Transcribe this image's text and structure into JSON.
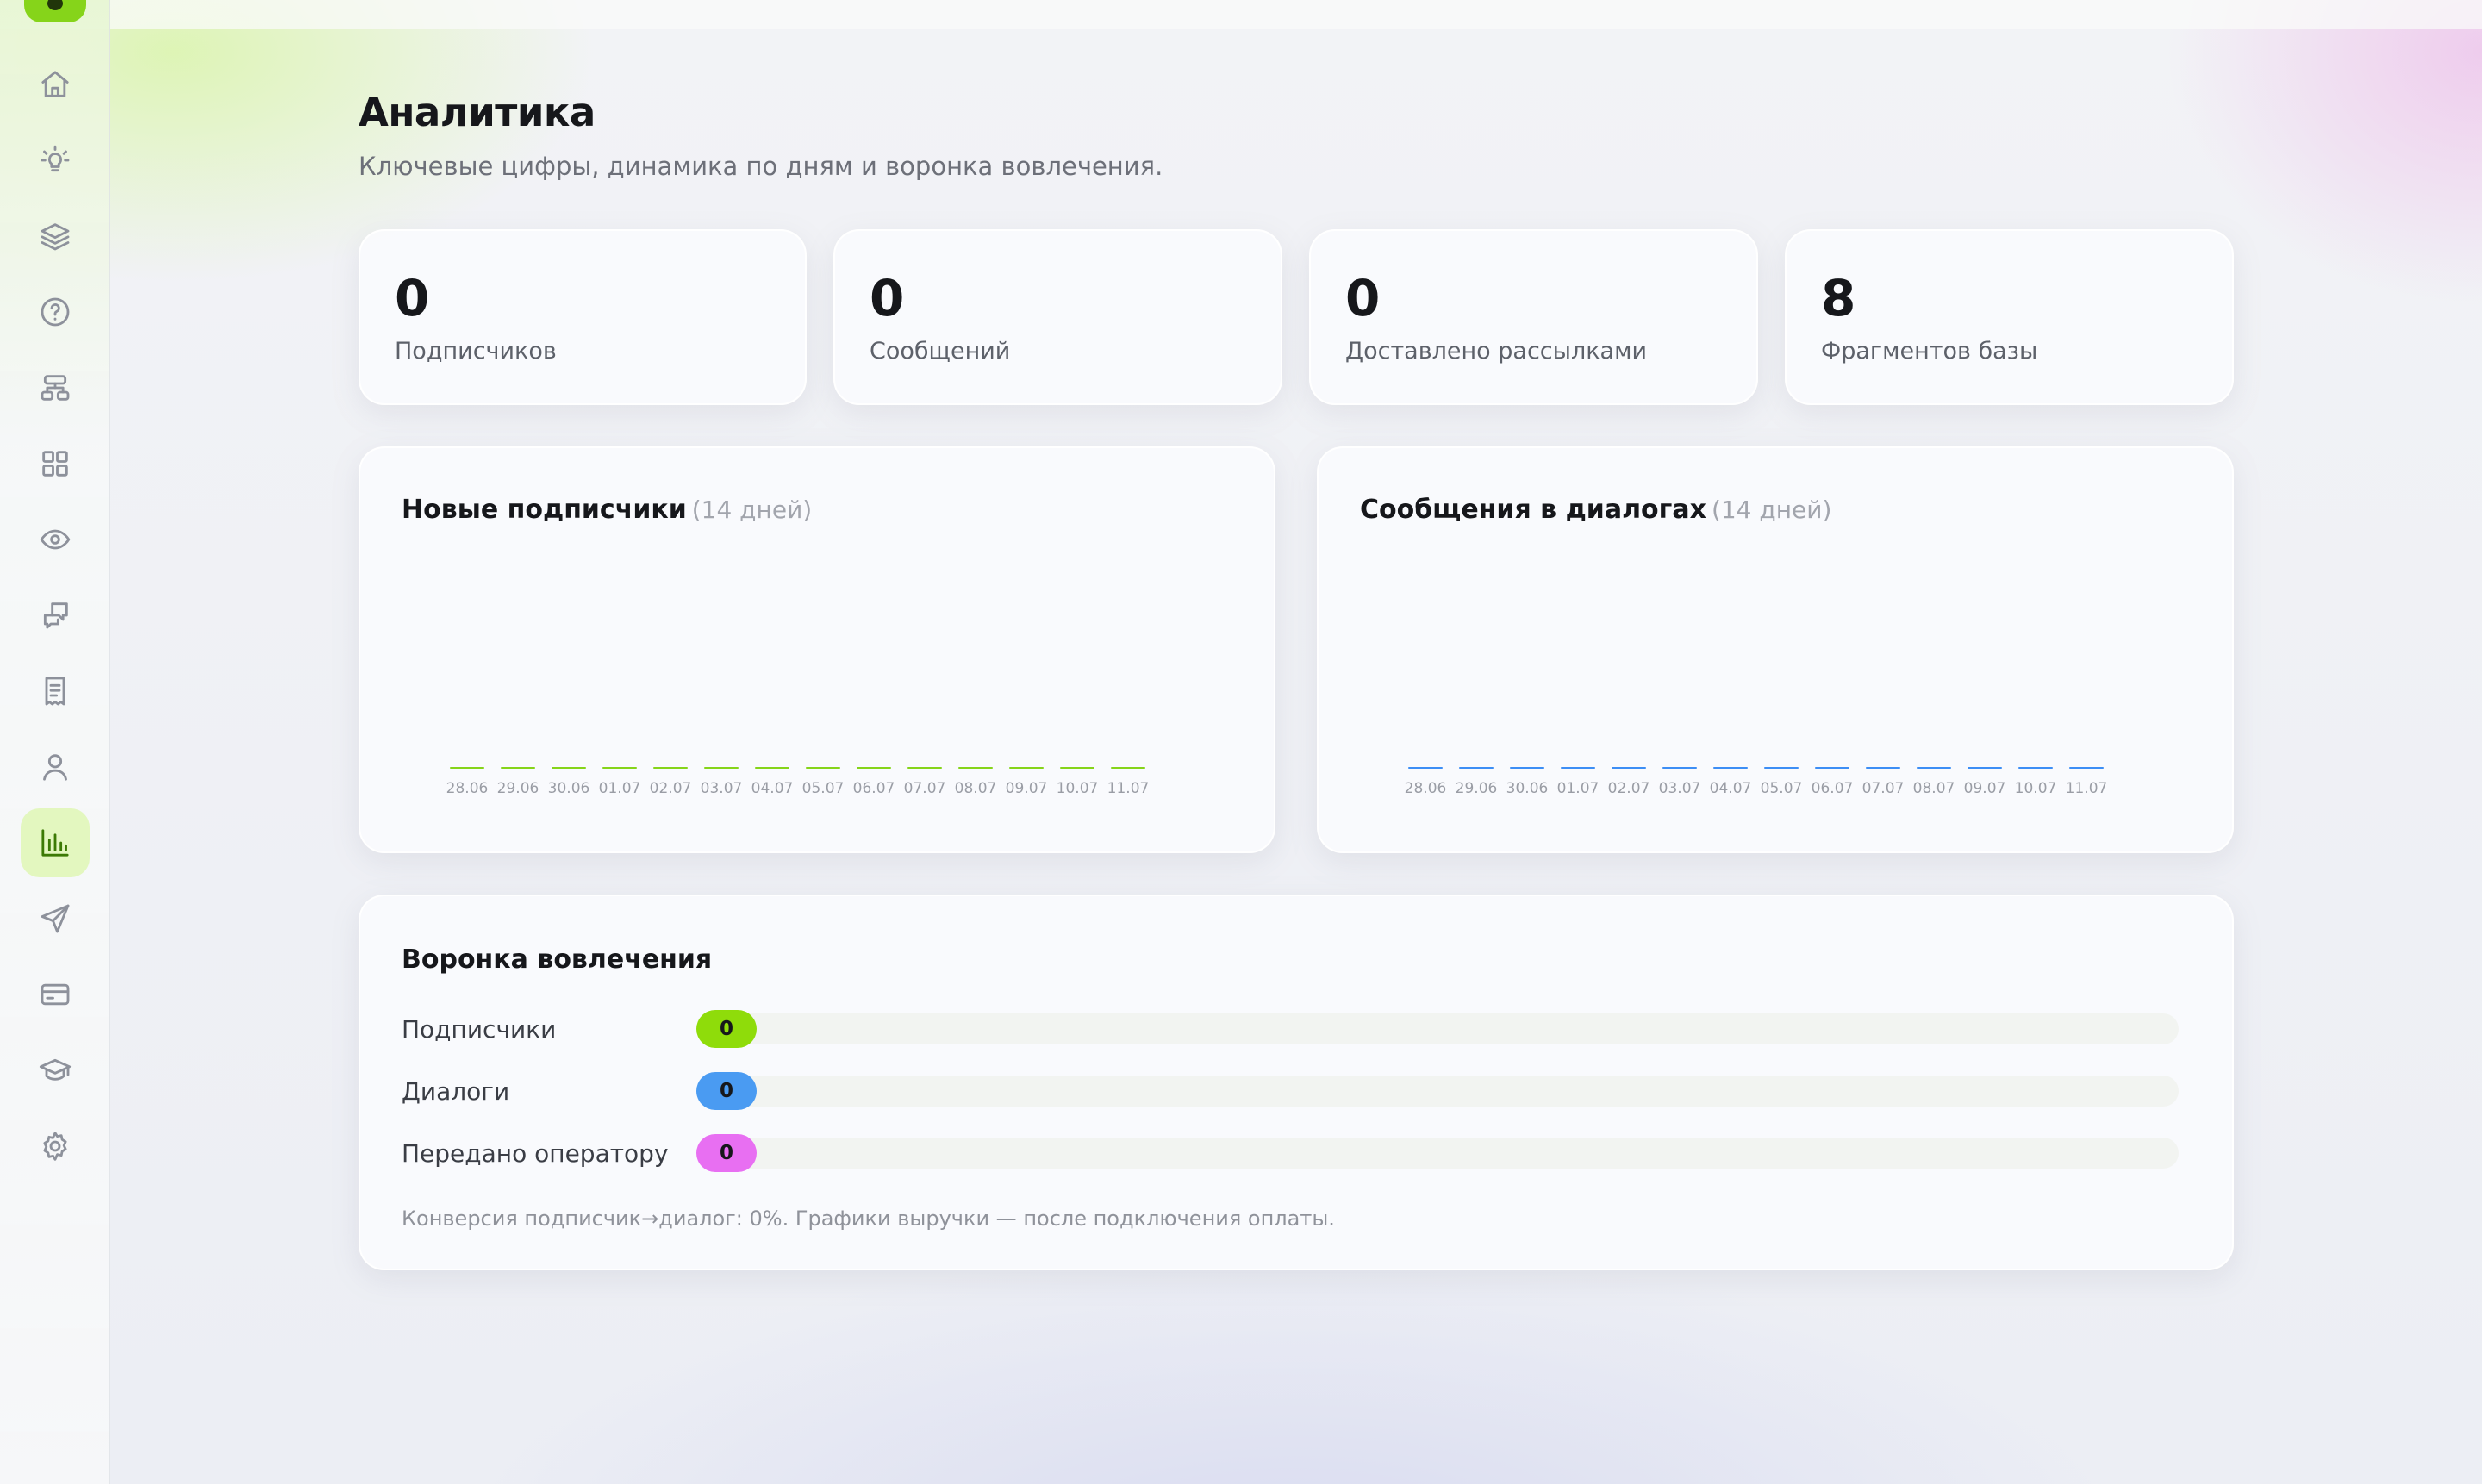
{
  "app": {
    "accent_color": "#86d41a"
  },
  "sidebar": {
    "items": [
      {
        "name": "home",
        "icon": "home-icon",
        "active": false
      },
      {
        "name": "ideas",
        "icon": "lightbulb-icon",
        "active": false
      },
      {
        "name": "knowledge",
        "icon": "layers-icon",
        "active": false
      },
      {
        "name": "faq",
        "icon": "help-circle-icon",
        "active": false
      },
      {
        "name": "flows",
        "icon": "workflow-icon",
        "active": false
      },
      {
        "name": "apps",
        "icon": "grid-icon",
        "active": false
      },
      {
        "name": "preview",
        "icon": "eye-icon",
        "active": false
      },
      {
        "name": "dialogs",
        "icon": "chat-bubbles-icon",
        "active": false
      },
      {
        "name": "logs",
        "icon": "receipt-icon",
        "active": false
      },
      {
        "name": "subscribers",
        "icon": "user-icon",
        "active": false
      },
      {
        "name": "analytics",
        "icon": "bar-chart-icon",
        "active": true
      },
      {
        "name": "broadcasts",
        "icon": "send-icon",
        "active": false
      },
      {
        "name": "billing",
        "icon": "credit-card-icon",
        "active": false
      },
      {
        "name": "learning",
        "icon": "graduation-cap-icon",
        "active": false
      },
      {
        "name": "settings",
        "icon": "gear-icon",
        "active": false
      }
    ]
  },
  "header": {
    "title": "Аналитика",
    "subtitle": "Ключевые цифры, динамика по дням и воронка вовлечения."
  },
  "stats": [
    {
      "value": "0",
      "label": "Подписчиков"
    },
    {
      "value": "0",
      "label": "Сообщений"
    },
    {
      "value": "0",
      "label": "Доставлено рассылками"
    },
    {
      "value": "8",
      "label": "Фрагментов базы"
    }
  ],
  "chart_data": [
    {
      "type": "bar",
      "title": "Новые подписчики",
      "subtitle": "(14 дней)",
      "categories": [
        "28.06",
        "29.06",
        "30.06",
        "01.07",
        "02.07",
        "03.07",
        "04.07",
        "05.07",
        "06.07",
        "07.07",
        "08.07",
        "09.07",
        "10.07",
        "11.07"
      ],
      "values": [
        0,
        0,
        0,
        0,
        0,
        0,
        0,
        0,
        0,
        0,
        0,
        0,
        0,
        0
      ],
      "color": "#86d41a",
      "xlabel": "",
      "ylabel": ""
    },
    {
      "type": "bar",
      "title": "Сообщения в диалогах",
      "subtitle": "(14 дней)",
      "categories": [
        "28.06",
        "29.06",
        "30.06",
        "01.07",
        "02.07",
        "03.07",
        "04.07",
        "05.07",
        "06.07",
        "07.07",
        "08.07",
        "09.07",
        "10.07",
        "11.07"
      ],
      "values": [
        0,
        0,
        0,
        0,
        0,
        0,
        0,
        0,
        0,
        0,
        0,
        0,
        0,
        0
      ],
      "color": "#3d8ef5",
      "xlabel": "",
      "ylabel": ""
    }
  ],
  "funnel": {
    "title": "Воронка вовлечения",
    "rows": [
      {
        "label": "Подписчики",
        "value": "0",
        "color": "#8fdc0a"
      },
      {
        "label": "Диалоги",
        "value": "0",
        "color": "#4a9bf2"
      },
      {
        "label": "Передано оператору",
        "value": "0",
        "color": "#e86ff2"
      }
    ],
    "note": "Конверсия подписчик→диалог: 0%. Графики выручки — после подключения оплаты."
  }
}
